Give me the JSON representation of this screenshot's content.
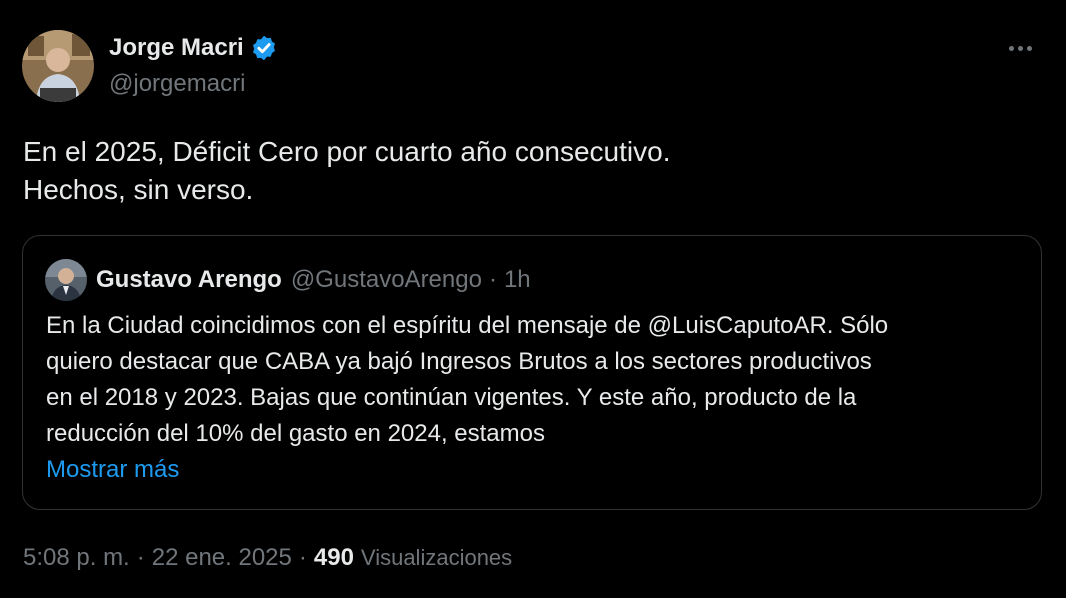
{
  "tweet": {
    "author_name": "Jorge Macri",
    "author_handle": "@jorgemacri",
    "text_lines": [
      "En el 2025, Déficit Cero por cuarto año consecutivo.",
      "Hechos, sin verso."
    ],
    "time": "5:08 p. m.",
    "date": "22 ene. 2025",
    "separator": "·",
    "views_count": "490",
    "views_label": "Visualizaciones"
  },
  "quote": {
    "author_name": "Gustavo Arengo",
    "author_handle": "@GustavoArengo",
    "separator": "·",
    "time": "1h",
    "text_lines": [
      "En la Ciudad coincidimos con el espíritu del mensaje de @LuisCaputoAR. Sólo",
      "quiero destacar que CABA ya bajó Ingresos Brutos a los sectores productivos",
      "en el 2018 y 2023. Bajas que continúan vigentes. Y este año, producto de la",
      "reducción del 10% del gasto en 2024, estamos"
    ],
    "show_more": "Mostrar más"
  },
  "icons": {
    "verified": "verified-badge-icon",
    "more": "more-options-icon"
  },
  "colors": {
    "background": "#000000",
    "text_primary": "#e7e9ea",
    "text_secondary": "#71767b",
    "accent": "#1d9bf0",
    "border": "#2f3336"
  }
}
